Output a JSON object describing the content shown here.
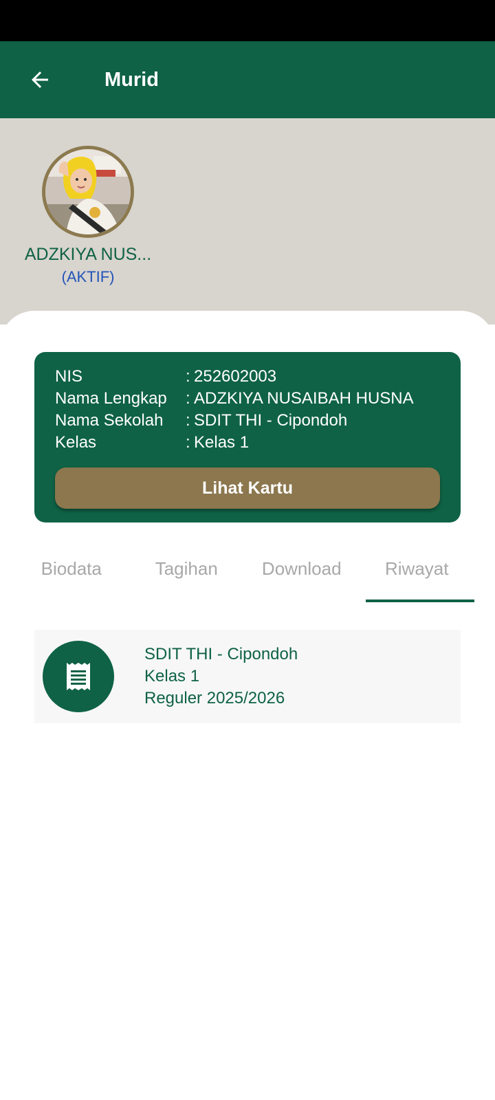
{
  "header": {
    "title": "Murid",
    "back_icon": "arrow-left-icon"
  },
  "profile": {
    "short_name": "ADZKIYA NUS...",
    "status": "(AKTIF)"
  },
  "card": {
    "rows": [
      {
        "label": "NIS",
        "sep": ":",
        "value": "252602003"
      },
      {
        "label": "Nama Lengkap",
        "sep": ":",
        "value": "ADZKIYA NUSAIBAH HUSNA"
      },
      {
        "label": "Nama Sekolah",
        "sep": ":",
        "value": "SDIT THI - Cipondoh"
      },
      {
        "label": "Kelas",
        "sep": ":",
        "value": "Kelas 1"
      }
    ],
    "button_label": "Lihat Kartu"
  },
  "tabs": [
    {
      "label": "Biodata"
    },
    {
      "label": "Tagihan"
    },
    {
      "label": "Download"
    },
    {
      "label": "Riwayat"
    }
  ],
  "active_tab": "Riwayat",
  "history": [
    {
      "icon": "receipt-icon",
      "school": "SDIT THI - Cipondoh",
      "class": "Kelas 1",
      "period": "Reguler 2025/2026"
    }
  ],
  "colors": {
    "primary": "#0f6245",
    "accent": "#8c774e",
    "profile_bg": "#d8d4ce",
    "status_blue": "#2254b8"
  }
}
